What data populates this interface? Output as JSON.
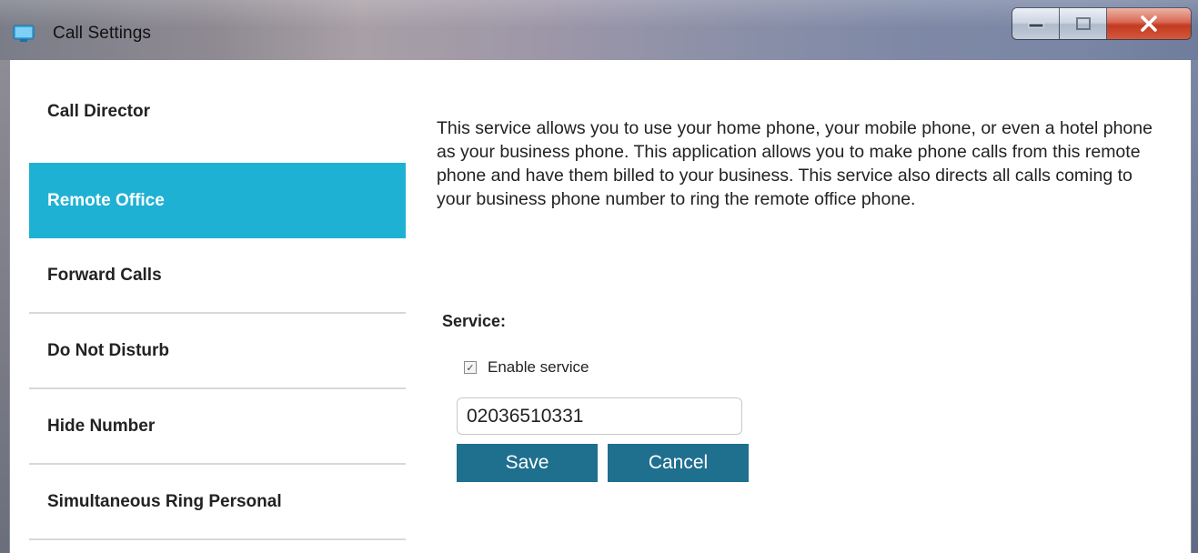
{
  "window": {
    "title": "Call Settings",
    "icon": "monitor-icon",
    "controls": {
      "minimize_icon": "minimize-icon",
      "maximize_icon": "maximize-icon",
      "close_icon": "close-icon"
    }
  },
  "nav": {
    "items": [
      {
        "label": "Call Director"
      },
      {
        "label": "Remote Office"
      },
      {
        "label": "Forward Calls"
      },
      {
        "label": "Do Not Disturb"
      },
      {
        "label": "Hide Number"
      },
      {
        "label": "Simultaneous Ring Personal"
      }
    ],
    "active_index": 1
  },
  "main": {
    "description": "This service allows you to use your home phone, your mobile phone, or even a hotel phone as your business phone. This application allows you to make phone calls from this remote phone and have them billed to your business. This service also directs all calls coming to your business phone number to ring the remote office phone.",
    "service_label": "Service:",
    "enable_label": "Enable service",
    "enable_checked": true,
    "phone_value": "02036510331",
    "save_label": "Save",
    "cancel_label": "Cancel"
  },
  "colors": {
    "active_nav": "#1fb1d4",
    "button": "#1f6f8f",
    "close_button": "#c2391f"
  }
}
